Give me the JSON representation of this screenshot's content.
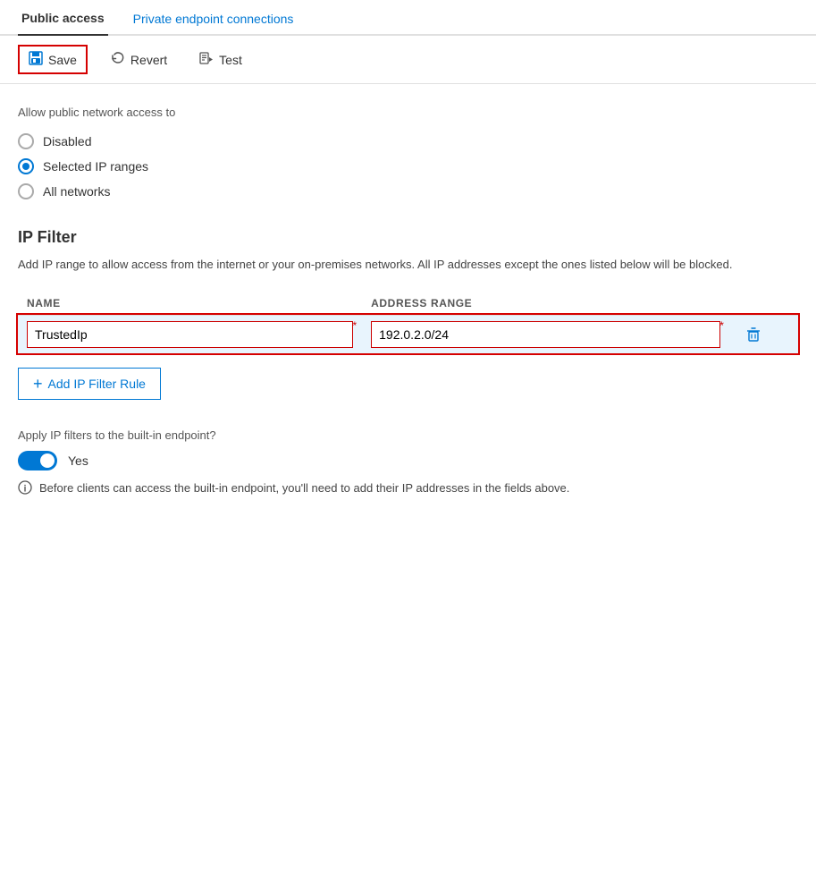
{
  "tabs": {
    "public_access": "Public access",
    "private_endpoint": "Private endpoint connections"
  },
  "toolbar": {
    "save_label": "Save",
    "revert_label": "Revert",
    "test_label": "Test"
  },
  "network_access": {
    "section_label": "Allow public network access to",
    "options": [
      {
        "id": "disabled",
        "label": "Disabled",
        "selected": false
      },
      {
        "id": "selected_ip_ranges",
        "label": "Selected IP ranges",
        "selected": true
      },
      {
        "id": "all_networks",
        "label": "All networks",
        "selected": false
      }
    ]
  },
  "ip_filter": {
    "title": "IP Filter",
    "description": "Add IP range to allow access from the internet or your on-premises networks. All IP addresses except the ones listed below will be blocked.",
    "columns": {
      "name": "NAME",
      "address_range": "ADDRESS RANGE"
    },
    "rules": [
      {
        "name": "TrustedIp",
        "address_range": "192.0.2.0/24"
      }
    ],
    "add_button_label": "Add IP Filter Rule"
  },
  "built_in_endpoint": {
    "label": "Apply IP filters to the built-in endpoint?",
    "toggle_value": true,
    "toggle_label": "Yes",
    "info_text": "Before clients can access the built-in endpoint, you'll need to add their IP addresses in the fields above."
  }
}
